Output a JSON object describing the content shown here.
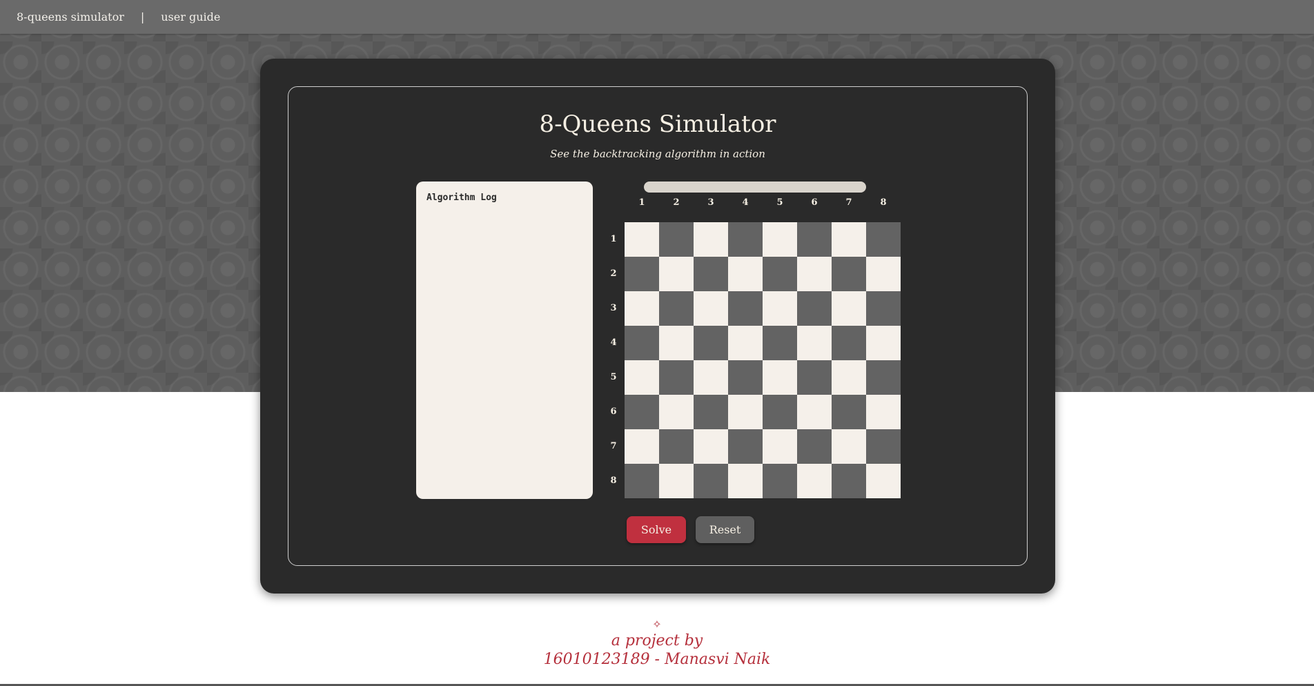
{
  "nav": {
    "home_label": "8-queens simulator",
    "separator": "|",
    "guide_label": "user guide"
  },
  "header": {
    "title": "8-Queens Simulator",
    "subtitle": "See the backtracking algorithm in action"
  },
  "log": {
    "title": "Algorithm Log"
  },
  "progress": {
    "value": 0
  },
  "board": {
    "size": 8,
    "col_labels": [
      "1",
      "2",
      "3",
      "4",
      "5",
      "6",
      "7",
      "8"
    ],
    "row_labels": [
      "1",
      "2",
      "3",
      "4",
      "5",
      "6",
      "7",
      "8"
    ],
    "light_color": "#f5f0ea",
    "dark_color": "#636363",
    "queens": []
  },
  "buttons": {
    "solve_label": "Solve",
    "reset_label": "Reset"
  },
  "footer": {
    "ornament": "✧",
    "line1": "a project by",
    "line2": "16010123189 - Manasvi Naik"
  },
  "colors": {
    "accent": "#c0303f",
    "card_bg": "#2a2a2a",
    "cream": "#f5f0ea"
  }
}
